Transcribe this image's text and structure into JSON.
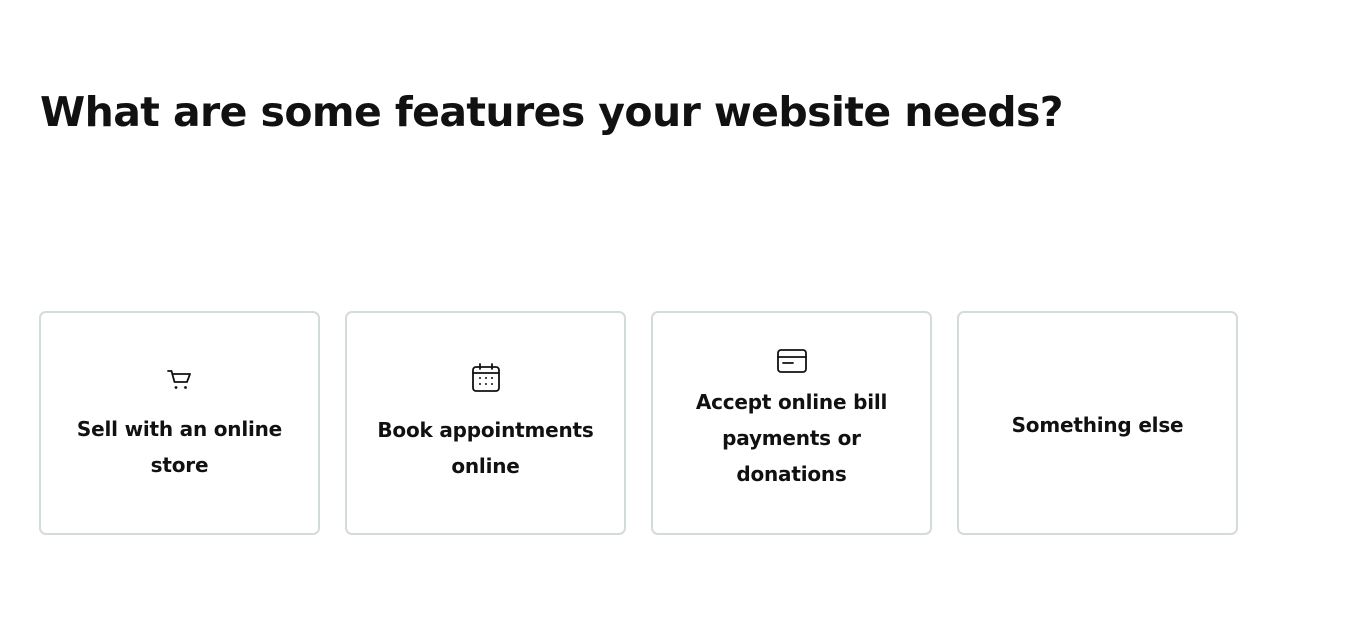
{
  "question": {
    "title": "What are some features your website needs?"
  },
  "options": [
    {
      "label": "Sell with an online store",
      "icon": "cart-icon"
    },
    {
      "label": "Book appointments online",
      "icon": "calendar-icon"
    },
    {
      "label": "Accept online bill payments or donations",
      "icon": "credit-card-icon"
    },
    {
      "label": "Something else",
      "icon": ""
    }
  ],
  "colors": {
    "text": "#111111",
    "card_border": "#d4dbdc",
    "background": "#ffffff"
  }
}
